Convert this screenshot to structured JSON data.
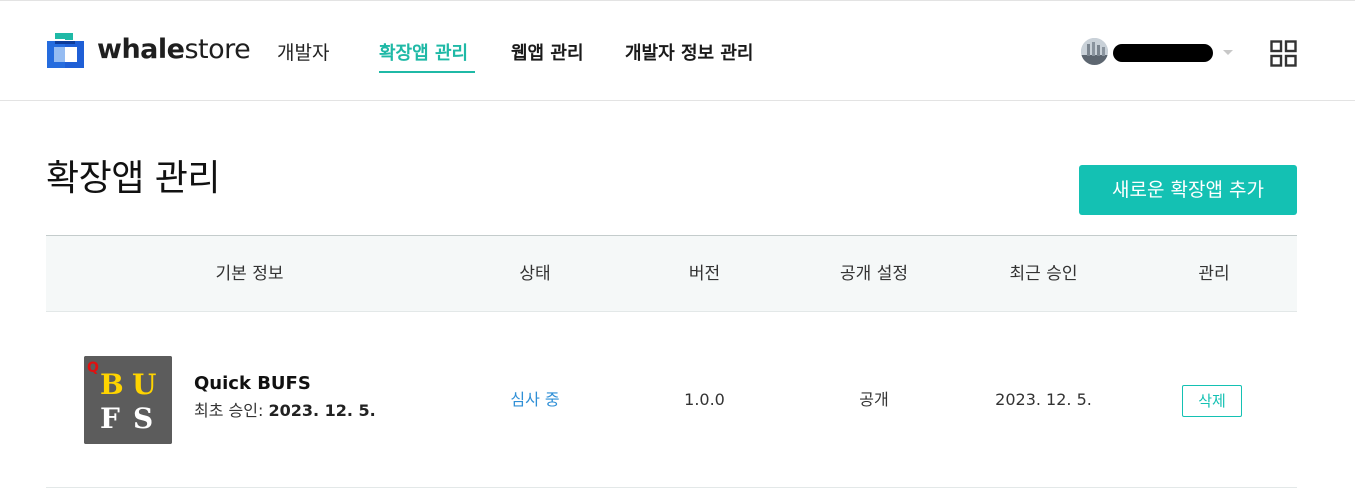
{
  "header": {
    "brand_bold": "whale",
    "brand_light": "store",
    "dev_label": "개발자",
    "nav": [
      {
        "label": "확장앱 관리",
        "active": true
      },
      {
        "label": "웹앱 관리",
        "active": false
      },
      {
        "label": "개발자 정보 관리",
        "active": false
      }
    ],
    "icons": {
      "logo": "whale-store-logo",
      "avatar": "user-avatar",
      "caret": "chevron-down-icon",
      "apps": "apps-grid-icon"
    },
    "accent_color": "#1fb9a6"
  },
  "page": {
    "title": "확장앱 관리",
    "add_button": "새로운 확장앱 추가",
    "button_color": "#14c1b3"
  },
  "table": {
    "columns": [
      "기본 정보",
      "상태",
      "버전",
      "공개 설정",
      "최근 승인",
      "관리"
    ],
    "rows": [
      {
        "thumb_text": [
          "Q",
          "B",
          "U",
          "F",
          "S"
        ],
        "name": "Quick BUFS",
        "approved_label": "최초 승인:",
        "approved_date": "2023. 12. 5.",
        "status": "심사 중",
        "version": "1.0.0",
        "visibility": "공개",
        "last_approved": "2023. 12. 5.",
        "action": "삭제"
      }
    ]
  }
}
